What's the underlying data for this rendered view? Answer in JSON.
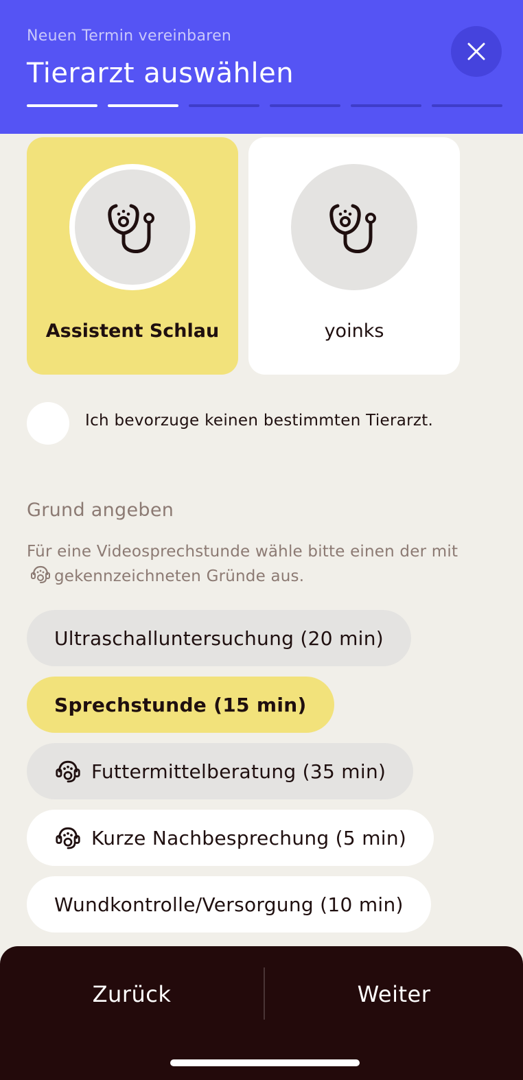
{
  "header": {
    "subtitle": "Neuen Termin vereinbaren",
    "title": "Tierarzt auswählen",
    "close_icon": "close-icon",
    "progress": {
      "total_steps": 6,
      "completed_steps": 2
    }
  },
  "vets": [
    {
      "name": "Assistent Schlau",
      "selected": true,
      "icon": "stethoscope-icon"
    },
    {
      "name": "yoinks",
      "selected": false,
      "icon": "stethoscope-icon"
    }
  ],
  "no_preference": {
    "label": "Ich bevorzuge keinen bestimmten Tierarzt.",
    "checked": false
  },
  "reason": {
    "title": "Grund angeben",
    "hint_before": "Für eine Videosprechstunde wähle bitte einen der mit",
    "hint_icon": "video-consult-icon",
    "hint_after": "gekennzeichneten Gründe aus.",
    "options": [
      {
        "label": "Ultraschalluntersuchung (20 min)",
        "selected": false,
        "video": false
      },
      {
        "label": "Sprechstunde (15 min)",
        "selected": true,
        "video": false
      },
      {
        "label": "Futtermittelberatung (35 min)",
        "selected": false,
        "video": true
      },
      {
        "label": "Kurze Nachbesprechung (5 min)",
        "selected": false,
        "video": true
      },
      {
        "label": "Wundkontrolle/Versorgung (10 min)",
        "selected": false,
        "video": false
      }
    ]
  },
  "footer": {
    "back_label": "Zurück",
    "next_label": "Weiter"
  },
  "colors": {
    "header_bg": "#5554f4",
    "accent_yellow": "#f2e27b",
    "page_bg": "#f1efe9",
    "footer_bg": "#230a0b"
  }
}
